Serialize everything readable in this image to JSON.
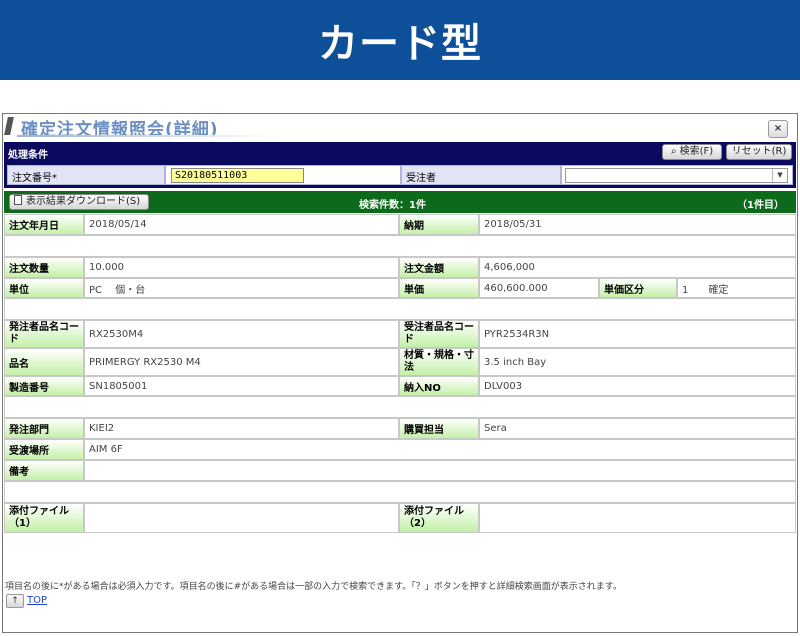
{
  "banner": {
    "title": "カード型"
  },
  "window": {
    "title": "確定注文情報照会(詳細)",
    "close_label": "×"
  },
  "conditions": {
    "title": "処理条件",
    "search_label": "検索(F)",
    "reset_label": "リセット(R)",
    "order_no_label": "注文番号*",
    "order_no_value": "S20180511003",
    "recipient_label": "受注者",
    "recipient_value": ""
  },
  "results": {
    "download_label": "表示結果ダウンロード(S)",
    "count_text": "検索件数：1件",
    "page_text": "（1件目）"
  },
  "detail": {
    "order_date_label": "注文年月日",
    "order_date": "2018/05/14",
    "due_label": "納期",
    "due": "2018/05/31",
    "qty_label": "注文数量",
    "qty": "10.000",
    "amount_label": "注文金額",
    "amount": "4,606,000",
    "unit_label": "単位",
    "unit": "PC　 個・台",
    "price_label": "単価",
    "price": "460,600.000",
    "price_type_label": "単価区分",
    "price_type": "1　　確定",
    "orderer_code_label": "発注者品名コード",
    "orderer_code": "RX2530M4",
    "recipient_code_label": "受注者品名コード",
    "recipient_code": "PYR2534R3N",
    "item_name_label": "品名",
    "item_name": "PRIMERGY RX2530 M4",
    "material_label": "材質・規格・寸法",
    "material": "3.5 inch Bay",
    "serial_label": "製造番号",
    "serial": "SN1805001",
    "delivery_no_label": "納入NO",
    "delivery_no": "DLV003",
    "dept_label": "発注部門",
    "dept": "KIEI2",
    "buyer_label": "購買担当",
    "buyer": "Sera",
    "place_label": "受渡場所",
    "place": "AIM 6F",
    "remarks_label": "備考",
    "remarks": "",
    "attach1_label": "添付ファイル（1）",
    "attach1": "",
    "attach2_label": "添付ファイル（2）",
    "attach2": ""
  },
  "footer": {
    "note": "項目名の後に*がある場合は必須入力です。項目名の後に#がある場合は一部の入力で検索できます。「？」ボタンを押すと詳細検索画面が表示されます。",
    "top_icon": "↑",
    "top_label": "TOP"
  },
  "colors": {
    "banner": "#0d4f98",
    "navy": "#0a0a5e",
    "green": "#0c6a1a",
    "label_green": "#c4f0a8",
    "input_yellow": "#ffff99"
  }
}
